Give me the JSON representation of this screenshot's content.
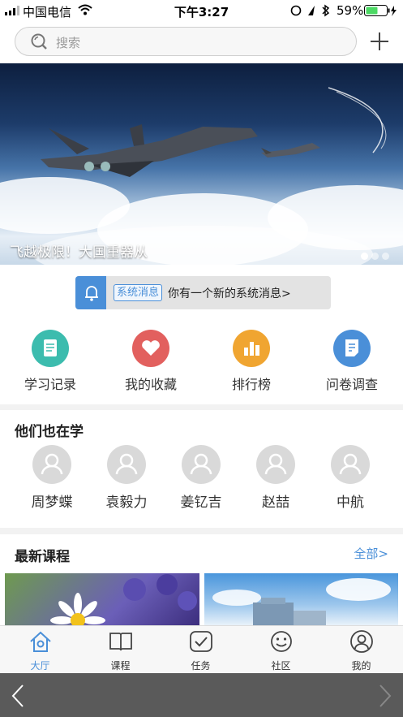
{
  "status_bar": {
    "carrier": "中国电信",
    "time": "下午3:27",
    "battery": "59%"
  },
  "search": {
    "placeholder": "搜索"
  },
  "banner": {
    "caption": "飞越极限！大国重器从"
  },
  "notice": {
    "tag": "系统消息",
    "text": "你有一个新的系统消息>"
  },
  "menu": [
    {
      "label": "学习记录",
      "icon": "study-record-icon",
      "color": "#3cbcae"
    },
    {
      "label": "我的收藏",
      "icon": "favorite-heart-icon",
      "color": "#e2605e"
    },
    {
      "label": "排行榜",
      "icon": "ranking-bar-icon",
      "color": "#f0a531"
    },
    {
      "label": "问卷调查",
      "icon": "survey-icon",
      "color": "#4a8fd8"
    }
  ],
  "learners": {
    "title": "他们也在学",
    "people": [
      "周梦蝶",
      "袁毅力",
      "姜钇吉",
      "赵喆",
      "中航"
    ]
  },
  "courses": {
    "title": "最新课程",
    "more": "全部>"
  },
  "tabs": [
    {
      "label": "大厅",
      "icon": "home-icon",
      "active": true
    },
    {
      "label": "课程",
      "icon": "book-icon",
      "active": false
    },
    {
      "label": "任务",
      "icon": "task-check-icon",
      "active": false
    },
    {
      "label": "社区",
      "icon": "community-smile-icon",
      "active": false
    },
    {
      "label": "我的",
      "icon": "profile-icon",
      "active": false
    }
  ],
  "colors": {
    "accent": "#4a8fd8"
  }
}
